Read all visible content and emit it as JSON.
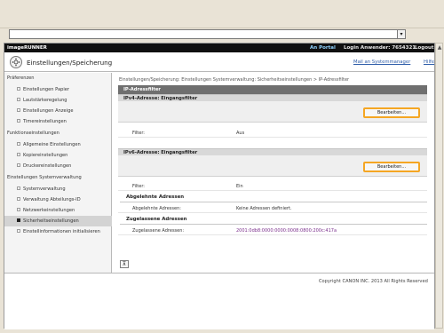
{
  "browser": {
    "dropdown_symbol": "▾"
  },
  "header": {
    "brand": "imageRUNNER",
    "portal": "An Portal",
    "login_label": "Login Anwender: 7654321",
    "logout": "Logout"
  },
  "title": {
    "text": "Einstellungen/Speicherung",
    "manager_link": "Mail an Systemmanager",
    "help_link": "Hilfe"
  },
  "sidebar": {
    "items": [
      {
        "label": "Präferenzen",
        "type": "category"
      },
      {
        "label": "Einstellungen Papier",
        "type": "item"
      },
      {
        "label": "Lautstärkeregelung",
        "type": "item"
      },
      {
        "label": "Einstellungen Anzeige",
        "type": "item"
      },
      {
        "label": "Timereinstellungen",
        "type": "item"
      },
      {
        "label": "Funktionseinstellungen",
        "type": "category"
      },
      {
        "label": "Allgemeine Einstellungen",
        "type": "item"
      },
      {
        "label": "Kopiereinstellungen",
        "type": "item"
      },
      {
        "label": "Druckereinstellungen",
        "type": "item"
      },
      {
        "label": "Einstellungen Systemverwaltung",
        "type": "category"
      },
      {
        "label": "Systemverwaltung",
        "type": "item"
      },
      {
        "label": "Verwaltung Abteilungs-ID",
        "type": "item"
      },
      {
        "label": "Netzwerkeinstellungen",
        "type": "item"
      },
      {
        "label": "Sicherheitseinstellungen",
        "type": "item",
        "active": true
      },
      {
        "label": "Einstellinformationen initialisieren",
        "type": "item"
      }
    ]
  },
  "content": {
    "breadcrumb": "Einstellungen/Speicherung: Einstellungen Systemverwaltung: Sicherheitseinstellungen > IP-Adressfilter",
    "panel_title": "IP-Adressfilter",
    "ipv4": {
      "heading": "IPv4-Adresse: Eingangsfilter",
      "button": "Bearbeiten...",
      "filter_label": "Filter:",
      "filter_value": "Aus"
    },
    "ipv6": {
      "heading": "IPv6-Adresse: Eingangsfilter",
      "button": "Bearbeiten...",
      "filter_label": "Filter:",
      "filter_value": "Ein",
      "rejected_section": "Abgelehnte Adressen",
      "rejected_label": "Abgelehnte Adressen:",
      "rejected_value": "Keine Adressen definiert.",
      "allowed_section": "Zugelassene Adressen",
      "allowed_label": "Zugelassene Adressen:",
      "allowed_value": "2001:0db8:0000:0000:0008:0800:200c:417a"
    },
    "top_button": "⊼"
  },
  "footer": {
    "copyright": "Copyright CANON INC. 2013 All Rights Reserved"
  },
  "colors": {
    "header_bg": "#101010",
    "portal_link": "#8fd3ff",
    "panel_title_bg": "#6f6f6f",
    "button_outline": "#f5a623",
    "link": "#2d5ca8"
  }
}
